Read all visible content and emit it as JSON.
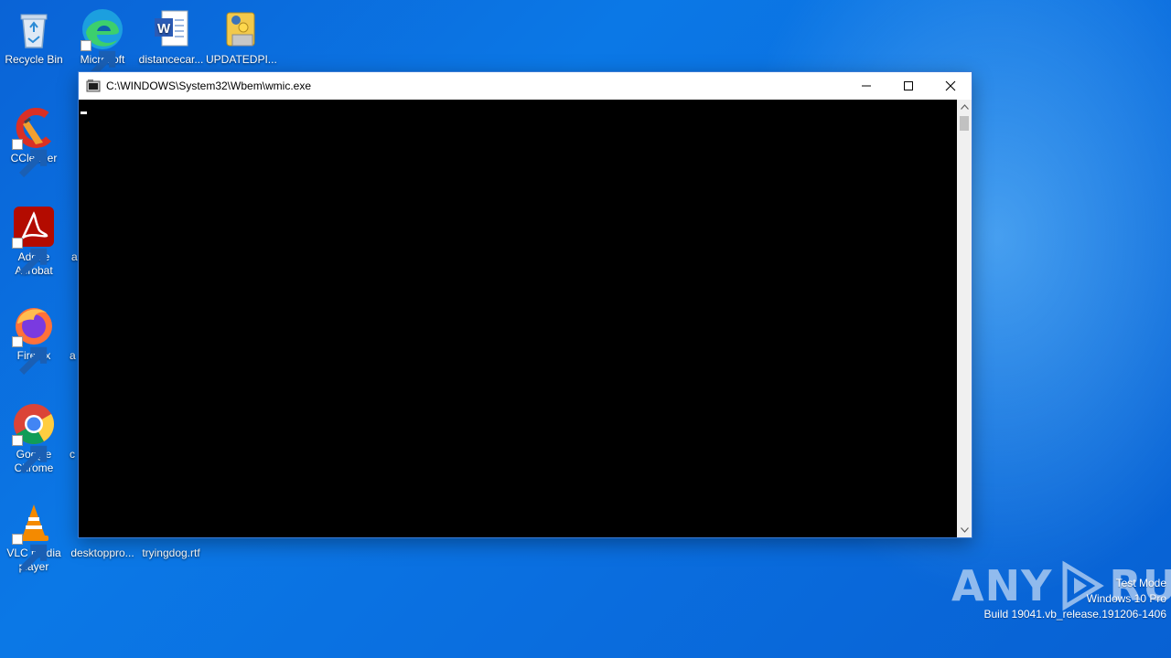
{
  "desktop": {
    "icons": [
      {
        "label": "Recycle Bin"
      },
      {
        "label": "Microsoft Edge"
      },
      {
        "label": "distancecar..."
      },
      {
        "label": "UPDATEDPI..."
      },
      {
        "label": "CCleaner"
      },
      {
        "label": "Adobe Acrobat"
      },
      {
        "label": "Firefox"
      },
      {
        "label": "Google Chrome"
      },
      {
        "label": "VLC media player"
      },
      {
        "label": "desktoppro..."
      },
      {
        "label": "tryingdog.rtf"
      }
    ],
    "partial_letters": [
      "a",
      "a",
      "c"
    ]
  },
  "window": {
    "title": "C:\\WINDOWS\\System32\\Wbem\\wmic.exe",
    "console_bg": "#000000",
    "cursor": "_"
  },
  "watermark": {
    "left": "ANY",
    "right": "RUN"
  },
  "system_info": {
    "line1": "Test Mode",
    "line2": "Windows 10 Pro",
    "line3": "Build 19041.vb_release.191206-1406"
  }
}
